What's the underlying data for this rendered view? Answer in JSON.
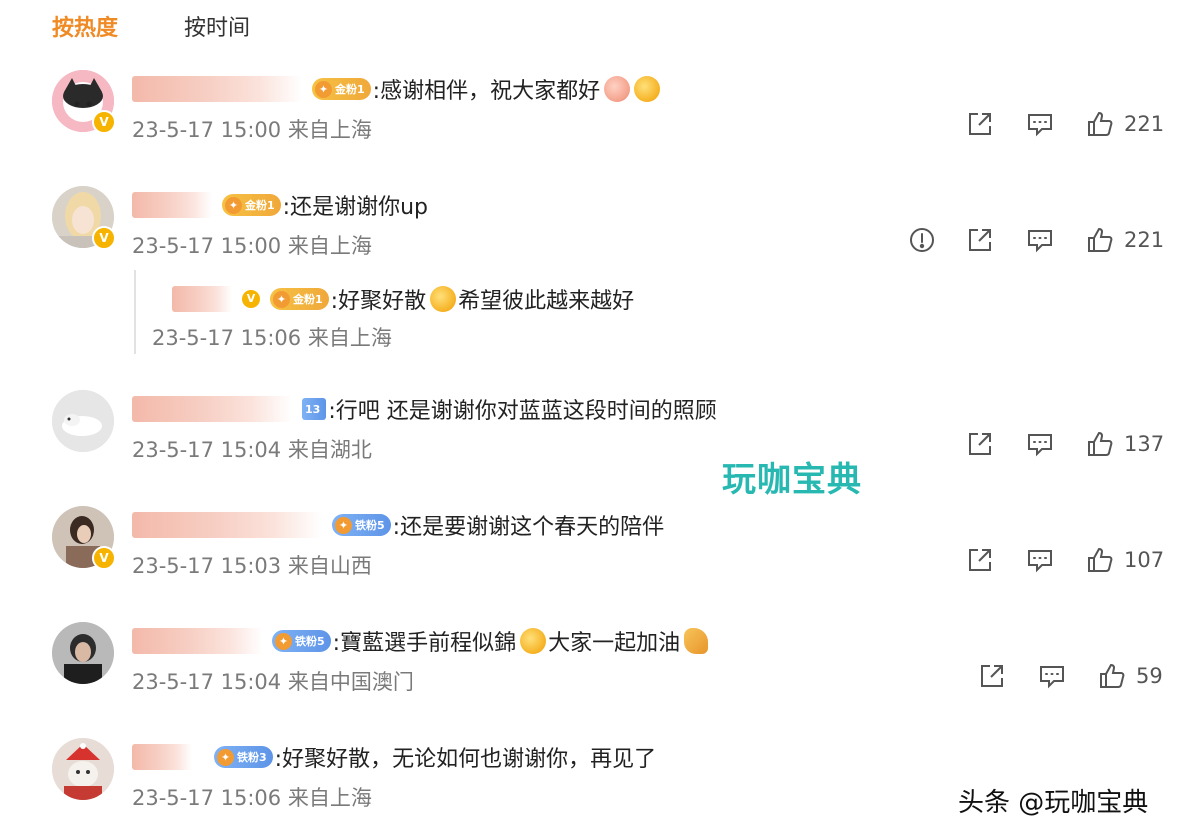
{
  "tabs": {
    "hot": "按热度",
    "time": "按时间"
  },
  "comments": [
    {
      "text": ":感谢相伴，祝大家都好",
      "meta": "23-5-17 15:00 来自上海",
      "likes": "221",
      "badge": "金粉1"
    },
    {
      "text": ":还是谢谢你up",
      "meta": "23-5-17 15:00 来自上海",
      "likes": "221",
      "badge": "金粉1"
    },
    {
      "text": ":行吧 还是谢谢你对蓝蓝这段时间的照顾",
      "meta": "23-5-17 15:04 来自湖北",
      "likes": "137",
      "badge": "13"
    },
    {
      "text": ":还是要谢谢这个春天的陪伴",
      "meta": "23-5-17 15:03 来自山西",
      "likes": "107",
      "badge": "铁粉5"
    },
    {
      "text_a": ":寶藍選手前程似錦",
      "text_b": "大家一起加油",
      "meta": "23-5-17 15:04 来自中国澳门",
      "likes": "59",
      "badge": "铁粉5"
    },
    {
      "text": ":好聚好散，无论如何也谢谢你，再见了",
      "meta": "23-5-17 15:06 来自上海",
      "badge": "铁粉3"
    }
  ],
  "reply": {
    "text_a": ":好聚好散",
    "text_b": "希望彼此越来越好",
    "meta": "23-5-17 15:06 来自上海",
    "badge": "金粉1"
  },
  "watermark_mid": "玩咖宝典",
  "watermark_br": "头条 @玩咖宝典",
  "colors": {
    "active_tab": "#f08a24",
    "meta_text": "#7a7a7a",
    "watermark": "#27b8b2",
    "gold_badge": "#f6c243",
    "blue_badge": "#5e94e8"
  },
  "icons": [
    "share-icon",
    "comment-icon",
    "like-icon",
    "report-icon",
    "verified-icon",
    "emoji-icon"
  ]
}
